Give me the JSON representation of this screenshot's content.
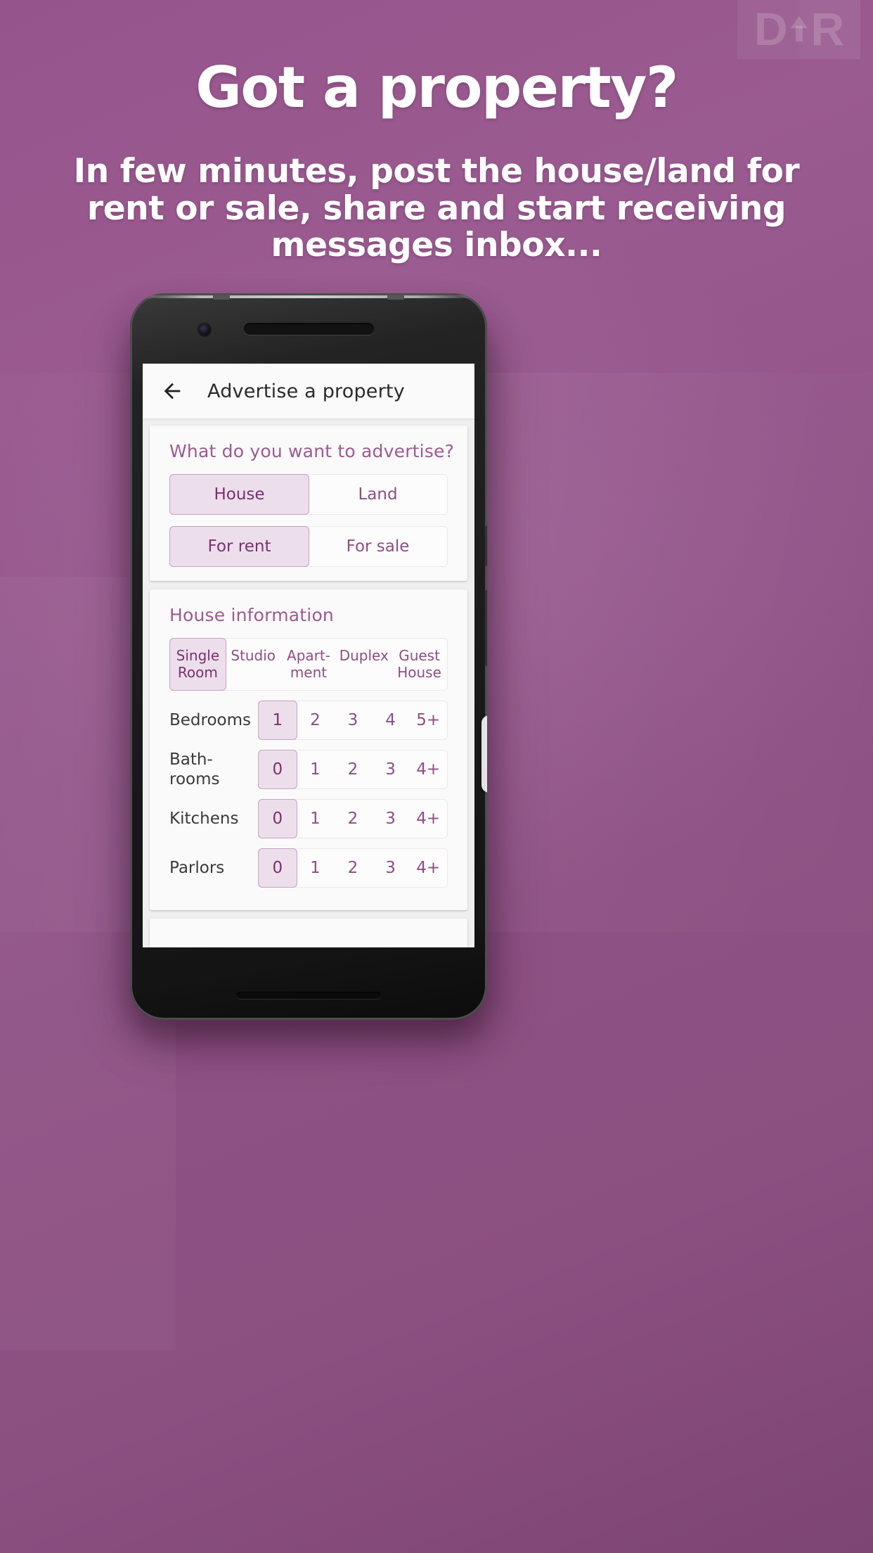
{
  "promo": {
    "headline": "Got a property?",
    "subhead": "In few minutes, post the house/land for rent or sale, share and start receiving messages inbox...",
    "watermark": {
      "left": "D",
      "right": "R",
      "arrow_icon": "arrow-up-icon"
    },
    "colors": {
      "background": "#96548c",
      "text": "#ffffff",
      "accent": "#8e4d85"
    }
  },
  "app": {
    "appbar": {
      "back_icon": "back-arrow-icon",
      "title": "Advertise a property"
    },
    "cards": [
      {
        "title": "What do you want to advertise?",
        "segments": [
          {
            "name": "property-kind",
            "options": [
              "House",
              "Land"
            ],
            "selected": "House"
          },
          {
            "name": "listing-purpose",
            "options": [
              "For rent",
              "For sale"
            ],
            "selected": "For rent"
          }
        ]
      },
      {
        "title": "House information",
        "chips": {
          "name": "house-type",
          "options": [
            "Single Room",
            "Studio",
            "Apart- ment",
            "Duplex",
            "Guest House"
          ],
          "selected": "Single Room"
        },
        "counters": [
          {
            "label": "Bedrooms",
            "options": [
              "1",
              "2",
              "3",
              "4",
              "5+"
            ],
            "selected": "1"
          },
          {
            "label": "Bath- rooms",
            "options": [
              "0",
              "1",
              "2",
              "3",
              "4+"
            ],
            "selected": "0"
          },
          {
            "label": "Kitchens",
            "options": [
              "0",
              "1",
              "2",
              "3",
              "4+"
            ],
            "selected": "0"
          },
          {
            "label": "Parlors",
            "options": [
              "0",
              "1",
              "2",
              "3",
              "4+"
            ],
            "selected": "0"
          }
        ]
      },
      {
        "title": "",
        "partial": true
      }
    ]
  }
}
